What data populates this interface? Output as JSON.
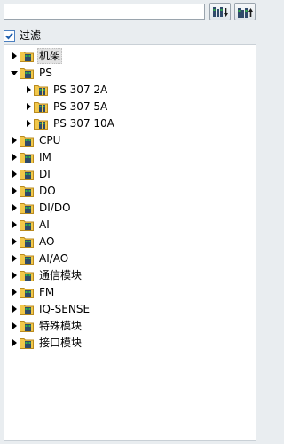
{
  "search": {
    "value": "",
    "placeholder": ""
  },
  "toolbar": {
    "expand_icon": "expand-all-icon",
    "collapse_icon": "collapse-all-icon"
  },
  "filter": {
    "label": "过滤",
    "checked": true
  },
  "tree": {
    "nodes": [
      {
        "label": "机架",
        "level": 0,
        "expanded": false,
        "selected": true
      },
      {
        "label": "PS",
        "level": 0,
        "expanded": true,
        "selected": false
      },
      {
        "label": "PS 307 2A",
        "level": 1,
        "expanded": false,
        "selected": false
      },
      {
        "label": "PS 307 5A",
        "level": 1,
        "expanded": false,
        "selected": false
      },
      {
        "label": "PS 307 10A",
        "level": 1,
        "expanded": false,
        "selected": false
      },
      {
        "label": "CPU",
        "level": 0,
        "expanded": false,
        "selected": false
      },
      {
        "label": "IM",
        "level": 0,
        "expanded": false,
        "selected": false
      },
      {
        "label": "DI",
        "level": 0,
        "expanded": false,
        "selected": false
      },
      {
        "label": "DO",
        "level": 0,
        "expanded": false,
        "selected": false
      },
      {
        "label": "DI/DO",
        "level": 0,
        "expanded": false,
        "selected": false
      },
      {
        "label": "AI",
        "level": 0,
        "expanded": false,
        "selected": false
      },
      {
        "label": "AO",
        "level": 0,
        "expanded": false,
        "selected": false
      },
      {
        "label": "AI/AO",
        "level": 0,
        "expanded": false,
        "selected": false
      },
      {
        "label": "通信模块",
        "level": 0,
        "expanded": false,
        "selected": false
      },
      {
        "label": "FM",
        "level": 0,
        "expanded": false,
        "selected": false
      },
      {
        "label": "IQ-SENSE",
        "level": 0,
        "expanded": false,
        "selected": false
      },
      {
        "label": "特殊模块",
        "level": 0,
        "expanded": false,
        "selected": false
      },
      {
        "label": "接口模块",
        "level": 0,
        "expanded": false,
        "selected": false
      }
    ]
  },
  "colors": {
    "folder": "#f2c84b",
    "folder_edge": "#b98a1f",
    "module_dark": "#2f4a6a",
    "module_green": "#33b34a",
    "arrow": "#000000"
  }
}
